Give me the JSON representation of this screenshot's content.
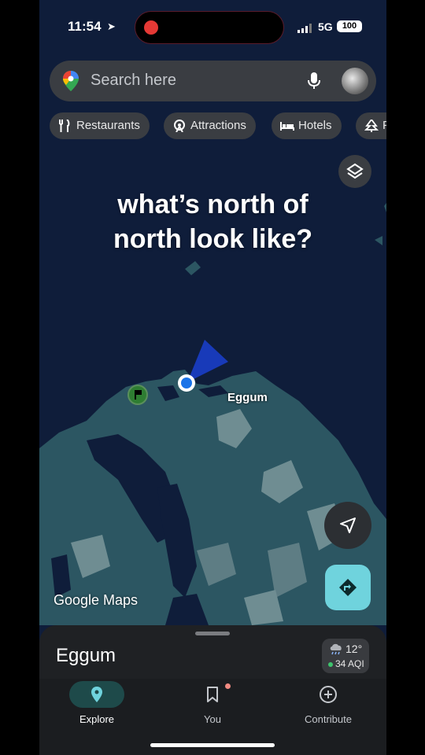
{
  "status_bar": {
    "time": "11:54",
    "network": "5G",
    "battery": "100"
  },
  "search": {
    "placeholder": "Search here"
  },
  "chips": [
    {
      "label": "Restaurants",
      "icon": "fork-knife-icon"
    },
    {
      "label": "Attractions",
      "icon": "ferris-wheel-icon"
    },
    {
      "label": "Hotels",
      "icon": "bed-icon"
    },
    {
      "label": "P",
      "icon": "tree-icon"
    }
  ],
  "caption": {
    "line1": "what’s north of",
    "line2": "north look like?"
  },
  "map": {
    "place_label": "Eggum",
    "watermark": "Google Maps",
    "water_color": "#0f1d3a",
    "land_color": "#2c5662",
    "location_dot_color": "#1a73e8"
  },
  "sheet": {
    "title": "Eggum",
    "weather_temp": "12°",
    "aqi": "34 AQI"
  },
  "nav": {
    "explore": "Explore",
    "you": "You",
    "contribute": "Contribute"
  }
}
